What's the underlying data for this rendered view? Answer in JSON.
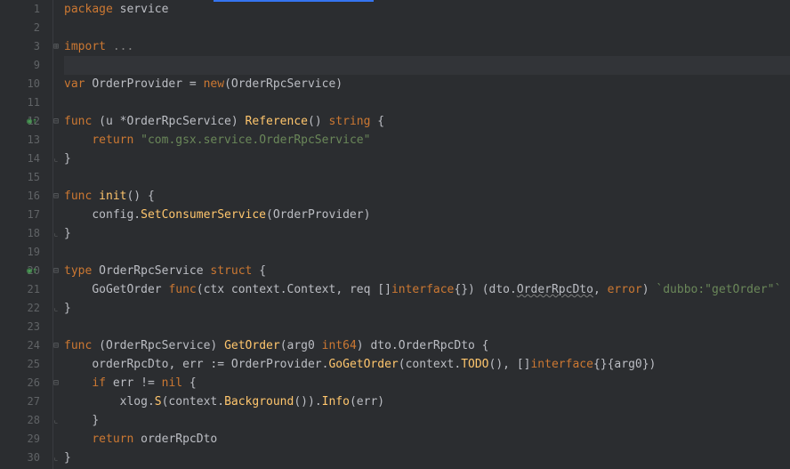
{
  "lines": [
    {
      "num": "1",
      "marker": "",
      "fold": "",
      "tokens": [
        [
          "k",
          "package "
        ],
        [
          "id",
          "service"
        ]
      ]
    },
    {
      "num": "2",
      "marker": "",
      "fold": "",
      "tokens": []
    },
    {
      "num": "3",
      "marker": "",
      "fold": "⊞",
      "tokens": [
        [
          "k",
          "import "
        ],
        [
          "dim",
          "..."
        ]
      ]
    },
    {
      "num": "9",
      "marker": "",
      "fold": "",
      "tokens": [],
      "highlight": true
    },
    {
      "num": "10",
      "marker": "",
      "fold": "",
      "tokens": [
        [
          "k",
          "var "
        ],
        [
          "id",
          "OrderProvider = "
        ],
        [
          "k",
          "new"
        ],
        [
          "op",
          "("
        ],
        [
          "id",
          "OrderRpcService"
        ],
        [
          "op",
          ")"
        ]
      ]
    },
    {
      "num": "11",
      "marker": "",
      "fold": "",
      "tokens": []
    },
    {
      "num": "12",
      "marker": "◉↑",
      "fold": "⊟",
      "tokens": [
        [
          "k",
          "func "
        ],
        [
          "op",
          "(u *"
        ],
        [
          "id",
          "OrderRpcService"
        ],
        [
          "op",
          ") "
        ],
        [
          "fn",
          "Reference"
        ],
        [
          "op",
          "() "
        ],
        [
          "k",
          "string"
        ],
        [
          "op",
          " {"
        ]
      ]
    },
    {
      "num": "13",
      "marker": "",
      "fold": "",
      "tokens": [
        [
          "id",
          "    "
        ],
        [
          "k",
          "return "
        ],
        [
          "s",
          "\"com.gsx.service.OrderRpcService\""
        ]
      ]
    },
    {
      "num": "14",
      "marker": "",
      "fold": "⌞",
      "tokens": [
        [
          "op",
          "}"
        ]
      ]
    },
    {
      "num": "15",
      "marker": "",
      "fold": "",
      "tokens": []
    },
    {
      "num": "16",
      "marker": "",
      "fold": "⊟",
      "tokens": [
        [
          "k",
          "func "
        ],
        [
          "fn",
          "init"
        ],
        [
          "op",
          "() {"
        ]
      ]
    },
    {
      "num": "17",
      "marker": "",
      "fold": "",
      "tokens": [
        [
          "id",
          "    config."
        ],
        [
          "fn",
          "SetConsumerService"
        ],
        [
          "op",
          "(OrderProvider)"
        ]
      ]
    },
    {
      "num": "18",
      "marker": "",
      "fold": "⌞",
      "tokens": [
        [
          "op",
          "}"
        ]
      ]
    },
    {
      "num": "19",
      "marker": "",
      "fold": "",
      "tokens": []
    },
    {
      "num": "20",
      "marker": "◉↑",
      "fold": "⊟",
      "tokens": [
        [
          "k",
          "type "
        ],
        [
          "id",
          "OrderRpcService "
        ],
        [
          "k",
          "struct"
        ],
        [
          "op",
          " {"
        ]
      ]
    },
    {
      "num": "21",
      "marker": "",
      "fold": "",
      "tokens": [
        [
          "id",
          "    GoGetOrder "
        ],
        [
          "k",
          "func"
        ],
        [
          "op",
          "(ctx "
        ],
        [
          "id",
          "context"
        ],
        [
          "op",
          "."
        ],
        [
          "id",
          "Context"
        ],
        [
          "op",
          ", req []"
        ],
        [
          "k",
          "interface"
        ],
        [
          "op",
          "{}) ("
        ],
        [
          "id",
          "dto"
        ],
        [
          "op",
          "."
        ],
        [
          "und",
          "OrderRpcDto"
        ],
        [
          "op",
          ", "
        ],
        [
          "k",
          "error"
        ],
        [
          "op",
          ") "
        ],
        [
          "s",
          "`dubbo:\"getOrder\"`"
        ]
      ]
    },
    {
      "num": "22",
      "marker": "",
      "fold": "⌞",
      "tokens": [
        [
          "op",
          "}"
        ]
      ]
    },
    {
      "num": "23",
      "marker": "",
      "fold": "",
      "tokens": []
    },
    {
      "num": "24",
      "marker": "",
      "fold": "⊟",
      "tokens": [
        [
          "k",
          "func "
        ],
        [
          "op",
          "(OrderRpcService) "
        ],
        [
          "fn",
          "GetOrder"
        ],
        [
          "op",
          "(arg0 "
        ],
        [
          "k",
          "int64"
        ],
        [
          "op",
          ") dto.OrderRpcDto {"
        ]
      ]
    },
    {
      "num": "25",
      "marker": "",
      "fold": "",
      "tokens": [
        [
          "id",
          "    orderRpcDto"
        ],
        [
          "op",
          ", "
        ],
        [
          "id",
          "err"
        ],
        [
          "op",
          " := OrderProvider."
        ],
        [
          "fn",
          "GoGetOrder"
        ],
        [
          "op",
          "(context."
        ],
        [
          "fn",
          "TODO"
        ],
        [
          "op",
          "(), []"
        ],
        [
          "k",
          "interface"
        ],
        [
          "op",
          "{}{arg0})"
        ]
      ]
    },
    {
      "num": "26",
      "marker": "",
      "fold": "⊟",
      "tokens": [
        [
          "id",
          "    "
        ],
        [
          "k",
          "if "
        ],
        [
          "id",
          "err"
        ],
        [
          "op",
          " != "
        ],
        [
          "k",
          "nil"
        ],
        [
          "op",
          " {"
        ]
      ]
    },
    {
      "num": "27",
      "marker": "",
      "fold": "",
      "tokens": [
        [
          "id",
          "        xlog."
        ],
        [
          "fn",
          "S"
        ],
        [
          "op",
          "(context."
        ],
        [
          "fn",
          "Background"
        ],
        [
          "op",
          "())."
        ],
        [
          "fn",
          "Info"
        ],
        [
          "op",
          "(err)"
        ]
      ]
    },
    {
      "num": "28",
      "marker": "",
      "fold": "⌞",
      "tokens": [
        [
          "id",
          "    "
        ],
        [
          "op",
          "}"
        ]
      ]
    },
    {
      "num": "29",
      "marker": "",
      "fold": "",
      "tokens": [
        [
          "id",
          "    "
        ],
        [
          "k",
          "return "
        ],
        [
          "id",
          "orderRpcDto"
        ]
      ]
    },
    {
      "num": "30",
      "marker": "",
      "fold": "⌞",
      "tokens": [
        [
          "op",
          "}"
        ]
      ]
    }
  ]
}
